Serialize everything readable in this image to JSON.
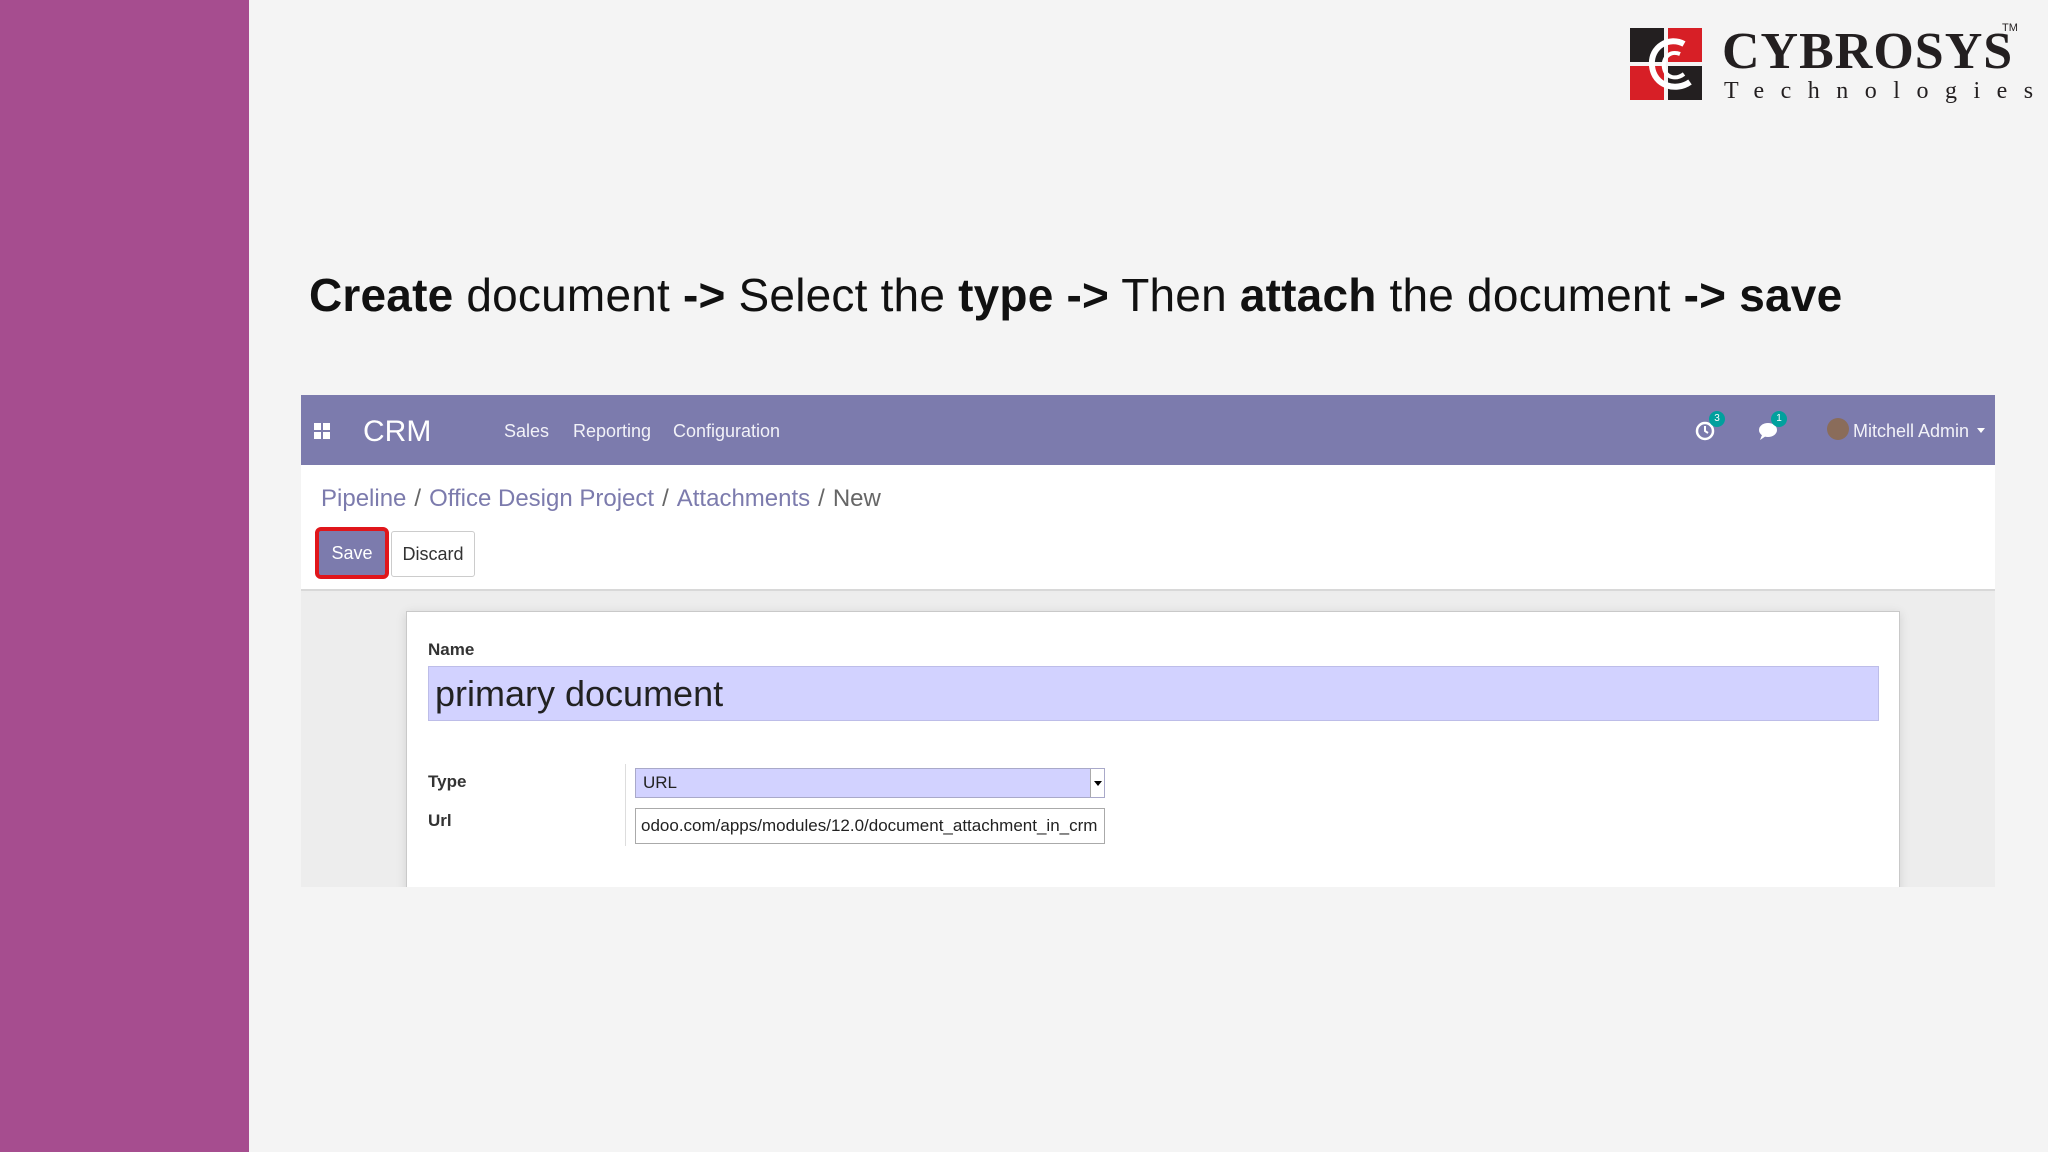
{
  "logo": {
    "word": "CYBROSYS",
    "tm": "TM",
    "sub": "Technologies"
  },
  "instruction": {
    "parts": [
      {
        "text": "Create",
        "bold": true
      },
      {
        "text": " document ",
        "bold": false
      },
      {
        "text": "->",
        "bold": true
      },
      {
        "text": " Select the ",
        "bold": false
      },
      {
        "text": "type",
        "bold": true
      },
      {
        "text": " ",
        "bold": false
      },
      {
        "text": "->",
        "bold": true
      },
      {
        "text": " Then ",
        "bold": false
      },
      {
        "text": "attach",
        "bold": true
      },
      {
        "text": " the document ",
        "bold": false
      },
      {
        "text": "-> save",
        "bold": true
      }
    ]
  },
  "navbar": {
    "brand": "CRM",
    "menu": [
      "Sales",
      "Reporting",
      "Configuration"
    ],
    "activity_count": "3",
    "message_count": "1",
    "user": "Mitchell Admin"
  },
  "breadcrumb": {
    "items": [
      "Pipeline",
      "Office Design Project",
      "Attachments"
    ],
    "current": "New",
    "separator": "/"
  },
  "buttons": {
    "save": "Save",
    "discard": "Discard"
  },
  "form": {
    "name_label": "Name",
    "name_value": "primary document",
    "type_label": "Type",
    "type_value": "URL",
    "url_label": "Url",
    "url_value": "odoo.com/apps/modules/12.0/document_attachment_in_crm"
  },
  "colors": {
    "sidebar": "#a64d8f",
    "navbar": "#7c7bad",
    "highlight": "#e0161b",
    "field_bg": "#d2d2ff"
  }
}
